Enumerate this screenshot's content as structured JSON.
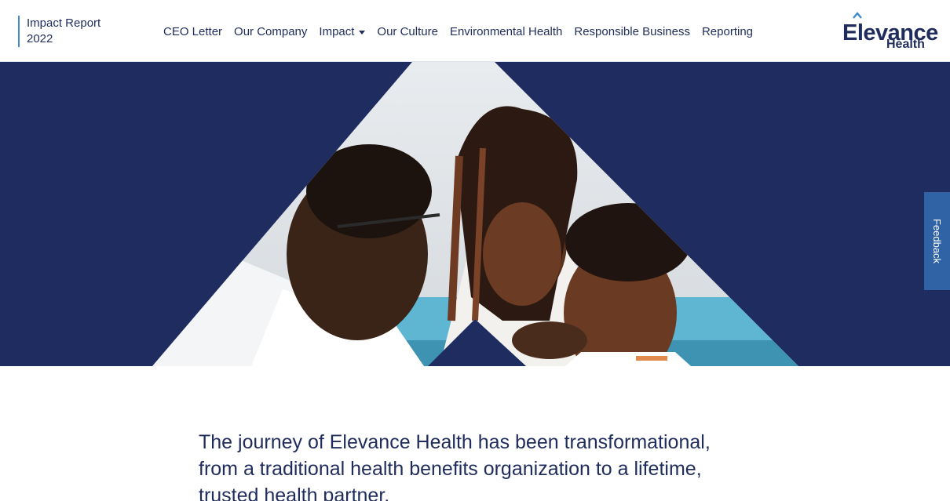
{
  "header": {
    "report_title_line1": "Impact Report",
    "report_title_line2": "2022",
    "nav": [
      {
        "label": "CEO Letter"
      },
      {
        "label": "Our Company"
      },
      {
        "label": "Impact",
        "has_dropdown": true
      },
      {
        "label": "Our Culture"
      },
      {
        "label": "Environmental Health"
      },
      {
        "label": "Responsible Business"
      },
      {
        "label": "Reporting"
      }
    ],
    "logo_word": "Elevance",
    "logo_sub": "Health"
  },
  "feedback_tab": "Feedback",
  "intro_text": "The journey of Elevance Health has been transformational, from a traditional health benefits organization to a lifetime, trusted health partner.",
  "colors": {
    "navy": "#1f2c60",
    "accent_blue": "#3c8bd3",
    "feedback_bg": "#2f63a6"
  },
  "hero_image": "photo-of-doctor-with-mother-and-baby-in-triangular-mask"
}
